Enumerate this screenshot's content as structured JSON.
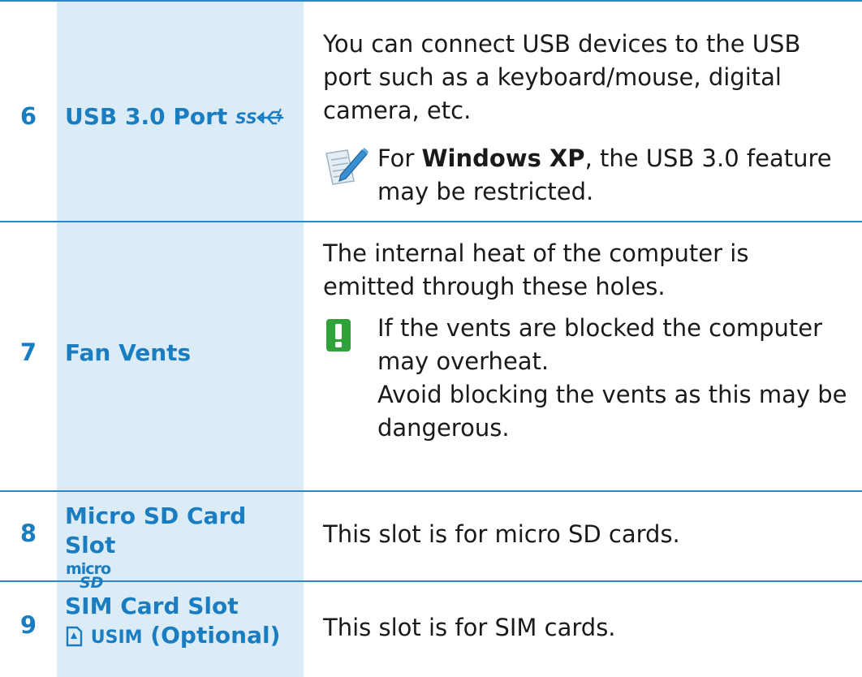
{
  "rows": [
    {
      "number": "6",
      "name": "USB 3.0 Port",
      "description": "You can connect USB devices to the USB port such as a keyboard/mouse, digital camera, etc.",
      "note": {
        "type": "memo",
        "before": "For ",
        "bold": "Windows XP",
        "after": ", the USB 3.0 feature may be restricted."
      }
    },
    {
      "number": "7",
      "name": "Fan Vents",
      "description": "The internal heat of the computer is emitted through these holes.",
      "note": {
        "type": "caution",
        "line1": "If the vents are blocked the computer may overheat.",
        "line2": "Avoid blocking the vents as this may be dangerous."
      }
    },
    {
      "number": "8",
      "name": "Micro SD Card Slot",
      "name_logo": "micro SD",
      "description": "This slot is for micro SD cards."
    },
    {
      "number": "9",
      "name": "SIM Card Slot",
      "sub_label": "USIM",
      "sub_suffix": "(Optional)",
      "description": "This slot is for SIM cards."
    }
  ],
  "colors": {
    "accent": "#1a7dc1",
    "name_column_bg": "#dcecf7",
    "rule": "#2f86c4",
    "caution": "#2fa33a"
  },
  "icons": [
    "usb-superspeed-icon",
    "memo-pen-icon",
    "caution-icon",
    "micro-sd-logo-icon",
    "sim-card-icon"
  ]
}
